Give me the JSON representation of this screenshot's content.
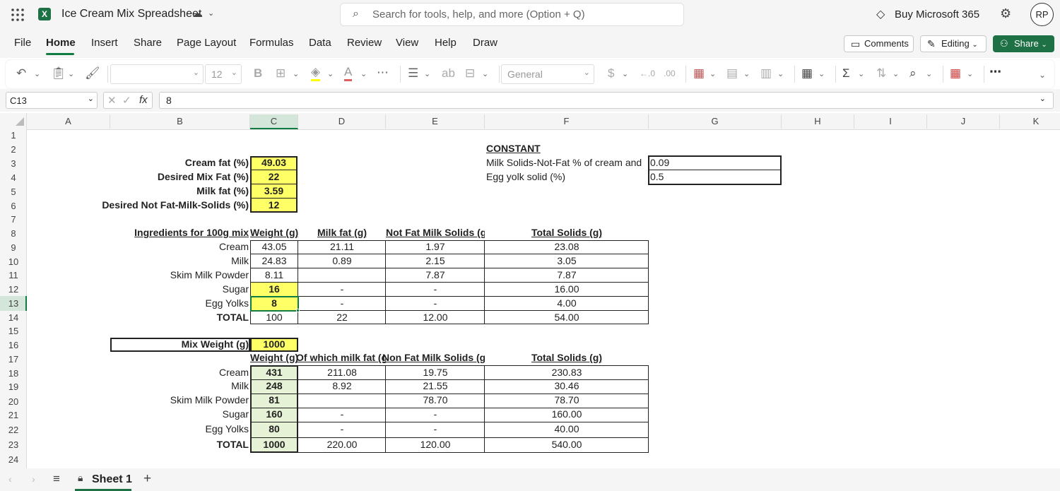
{
  "app": {
    "title": "Ice Cream Mix Spreadsheet",
    "search_placeholder": "Search for tools, help, and more (Option + Q)",
    "buy": "Buy Microsoft 365",
    "avatar": "RP"
  },
  "tabs": [
    "File",
    "Home",
    "Insert",
    "Share",
    "Page Layout",
    "Formulas",
    "Data",
    "Review",
    "View",
    "Help",
    "Draw"
  ],
  "actions": {
    "comments": "Comments",
    "editing": "Editing",
    "share": "Share"
  },
  "toolbar": {
    "font_size": "12",
    "number_format": "General"
  },
  "formula": {
    "namebox": "C13",
    "fx": "fx",
    "value": "8"
  },
  "columns": [
    "A",
    "B",
    "C",
    "D",
    "E",
    "F",
    "G",
    "H",
    "I",
    "J",
    "K"
  ],
  "rows": [
    "1",
    "2",
    "3",
    "4",
    "5",
    "6",
    "7",
    "8",
    "9",
    "10",
    "11",
    "12",
    "13",
    "14",
    "15",
    "16",
    "17",
    "18",
    "19",
    "20",
    "21",
    "22",
    "23",
    "24"
  ],
  "params": {
    "labels": [
      "Cream fat (%)",
      "Desired Mix Fat (%)",
      "Milk fat (%)",
      "Desired Not Fat-Milk-Solids (%)"
    ],
    "values": [
      "49.03",
      "22",
      "3.59",
      "12"
    ]
  },
  "constants": {
    "title": "CONSTANT",
    "l1": "Milk Solids-Not-Fat % of cream and",
    "v1": "0.09",
    "l2": "Egg yolk solid (%)",
    "v2": "0.5"
  },
  "t1": {
    "headers": [
      "Ingredients for 100g mix",
      "Weight (g)",
      "Milk fat (g)",
      "Not Fat Milk Solids (g",
      "Total Solids (g)"
    ],
    "rows": [
      [
        "Cream",
        "43.05",
        "21.11",
        "1.97",
        "23.08"
      ],
      [
        "Milk",
        "24.83",
        "0.89",
        "2.15",
        "3.05"
      ],
      [
        "Skim Milk Powder",
        "8.11",
        "",
        "7.87",
        "7.87"
      ],
      [
        "Sugar",
        "16",
        "-",
        "-",
        "16.00"
      ],
      [
        "Egg Yolks",
        "8",
        "-",
        "-",
        "4.00"
      ],
      [
        "TOTAL",
        "100",
        "22",
        "12.00",
        "54.00"
      ]
    ]
  },
  "mix": {
    "label": "Mix Weight (g)",
    "value": "1000"
  },
  "t2": {
    "headers": [
      "Weight (g)",
      "Of which milk fat (g",
      "Non Fat Milk Solids (g",
      "Total Solids (g)"
    ],
    "rows": [
      [
        "Cream",
        "431",
        "211.08",
        "19.75",
        "230.83"
      ],
      [
        "Milk",
        "248",
        "8.92",
        "21.55",
        "30.46"
      ],
      [
        "Skim Milk Powder",
        "81",
        "",
        "78.70",
        "78.70"
      ],
      [
        "Sugar",
        "160",
        "-",
        "-",
        "160.00"
      ],
      [
        "Egg Yolks",
        "80",
        "-",
        "-",
        "40.00"
      ],
      [
        "TOTAL",
        "1000",
        "220.00",
        "120.00",
        "540.00"
      ]
    ]
  },
  "sheet": {
    "name": "Sheet 1"
  },
  "colors": {
    "excel_green": "#1e7145",
    "selected": "#107c41",
    "yellow": "#ffff66",
    "light_green": "#e6f2d5"
  }
}
